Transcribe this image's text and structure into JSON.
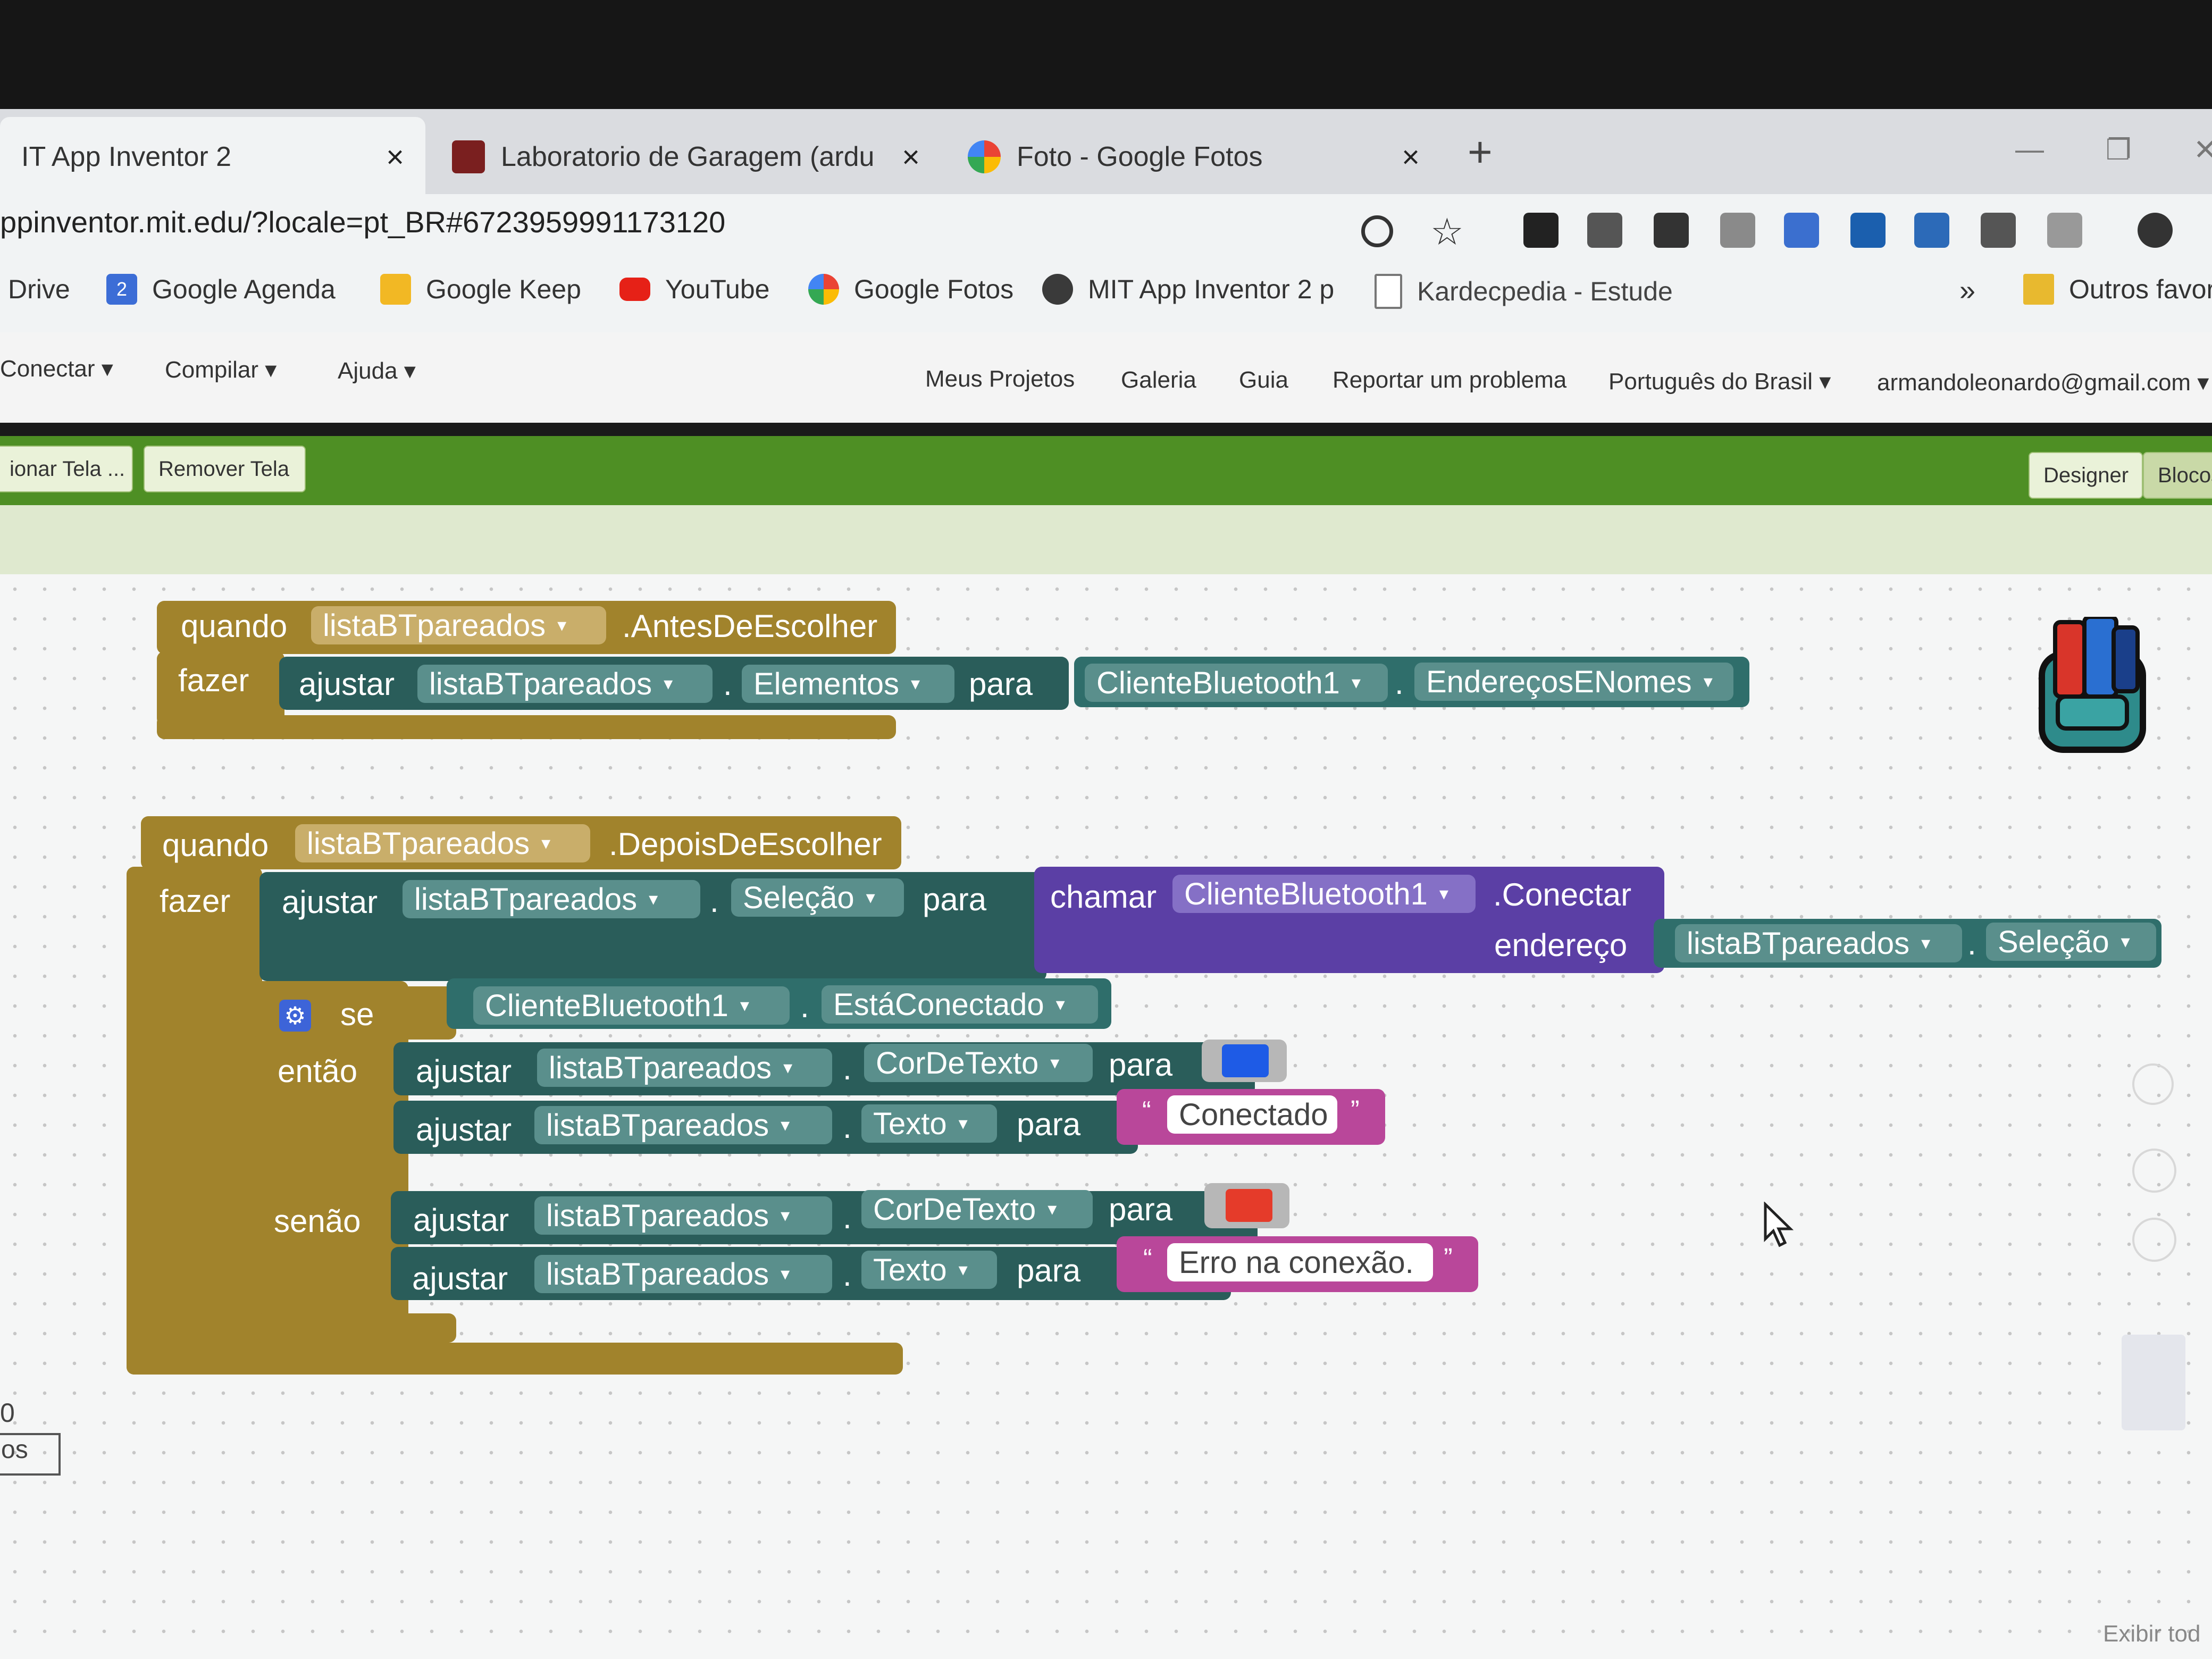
{
  "browser": {
    "tabs": [
      {
        "title": "IT App Inventor 2",
        "close": "×"
      },
      {
        "title": "Laboratorio de Garagem (arduino",
        "close": "×"
      },
      {
        "title": "Foto - Google Fotos",
        "close": "×"
      }
    ],
    "new_tab": "+",
    "window_controls": [
      "—",
      "❐",
      "✕"
    ],
    "url": "ppinventor.mit.edu/?locale=pt_BR#6723959991173120",
    "toolbar_icons": [
      "zoom-icon",
      "star-icon",
      "extension-icons"
    ],
    "bookmarks": [
      {
        "label": "Drive"
      },
      {
        "label": "Google Agenda",
        "badge": "2"
      },
      {
        "label": "Google Keep"
      },
      {
        "label": "YouTube"
      },
      {
        "label": "Google Fotos"
      },
      {
        "label": "MIT App Inventor 2 p"
      },
      {
        "label": "Kardecpedia - Estude"
      }
    ],
    "bookmarks_more": "»",
    "other_bookmarks": "Outros favorit"
  },
  "app": {
    "menu_left": [
      "Conectar",
      "Compilar",
      "Ajuda"
    ],
    "menu_right": [
      "Meus Projetos",
      "Galeria",
      "Guia",
      "Reportar um problema",
      "Português do Brasil",
      "armandoleonardo@gmail.com"
    ],
    "screen_buttons": [
      "ionar Tela ...",
      "Remover Tela"
    ],
    "mode_buttons": [
      "Designer",
      "Blocos"
    ],
    "left_fragments": [
      "0",
      "os"
    ],
    "bottom_right": "Exibir tod"
  },
  "blocks": {
    "block1": {
      "when": "quando",
      "component": "listaBTpareados",
      "event": ".AntesDeEscolher",
      "do": "fazer",
      "set": "ajustar",
      "set_component": "listaBTpareados",
      "dot": ".",
      "property": "Elementos",
      "to": "para",
      "value_component": "ClienteBluetooth1",
      "value_property": "EndereçosENomes"
    },
    "block2": {
      "when": "quando",
      "component": "listaBTpareados",
      "event": ".DepoisDeEscolher",
      "do": "fazer",
      "set": "ajustar",
      "set_component": "listaBTpareados",
      "property": "Seleção",
      "to": "para",
      "call": "chamar",
      "call_component": "ClienteBluetooth1",
      "method": ".Conectar",
      "address_label": "endereço",
      "address_component": "listaBTpareados",
      "address_property": "Seleção",
      "if": "se",
      "if_component": "ClienteBluetooth1",
      "if_property": "EstáConectado",
      "then": "então",
      "else": "senão",
      "then_1_component": "listaBTpareados",
      "then_1_property": "CorDeTexto",
      "then_1_color": "#1e5be6",
      "then_2_component": "listaBTpareados",
      "then_2_property": "Texto",
      "then_2_text": "Conectado",
      "else_1_component": "listaBTpareados",
      "else_1_property": "CorDeTexto",
      "else_1_color": "#e53b2a",
      "else_2_component": "listaBTpareados",
      "else_2_property": "Texto",
      "else_2_text": "Erro na conexão.",
      "quote_open": "“",
      "quote_close": "”",
      "dropdown": "▾"
    }
  },
  "colors": {
    "event_block": "#a1832c",
    "setter_block": "#2a5d5a",
    "procedure_block": "#5b3fa5",
    "text_block": "#b9479a",
    "green_bar": "#4e8f24"
  }
}
